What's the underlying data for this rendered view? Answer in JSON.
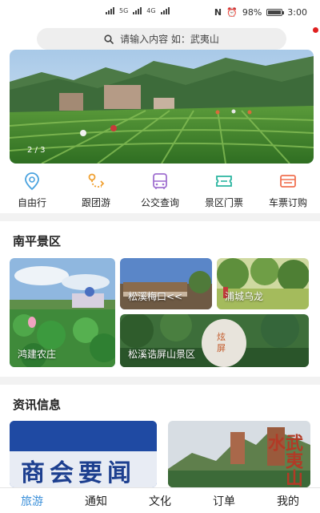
{
  "status_bar": {
    "left_text_1": "5G",
    "left_text_2": "4G",
    "battery": "98%",
    "time": "3:00",
    "battery_level": 0.98
  },
  "search": {
    "placeholder": "请输入内容  如：武夷山"
  },
  "banner": {
    "indicator": "2 / 3",
    "current_slide": 2,
    "total_slides": 3
  },
  "quick_menu": [
    {
      "label": "自由行",
      "icon": "location-pin-icon",
      "color": "#4aa3df"
    },
    {
      "label": "跟团游",
      "icon": "route-icon",
      "color": "#f0a030"
    },
    {
      "label": "公交查询",
      "icon": "bus-icon",
      "color": "#a070d0"
    },
    {
      "label": "景区门票",
      "icon": "ticket-icon",
      "color": "#2bb5a0"
    },
    {
      "label": "车票订购",
      "icon": "train-ticket-icon",
      "color": "#f07050"
    }
  ],
  "scenic": {
    "title": "南平景区",
    "cards": [
      {
        "label": "鸿建农庄"
      },
      {
        "label": "松溪梅口<<"
      },
      {
        "label": "浦城乌龙"
      },
      {
        "label": "松溪诰屏山景区"
      }
    ]
  },
  "news": {
    "title": "资讯信息",
    "cards": [
      {
        "text": "商会要闻"
      },
      {
        "text": "武夷山水"
      }
    ]
  },
  "bottom_nav": {
    "items": [
      {
        "label": "旅游",
        "active": true
      },
      {
        "label": "通知",
        "active": false
      },
      {
        "label": "文化",
        "active": false
      },
      {
        "label": "订单",
        "active": false
      },
      {
        "label": "我的",
        "active": false
      }
    ],
    "active_color": "#3a8fd9"
  }
}
